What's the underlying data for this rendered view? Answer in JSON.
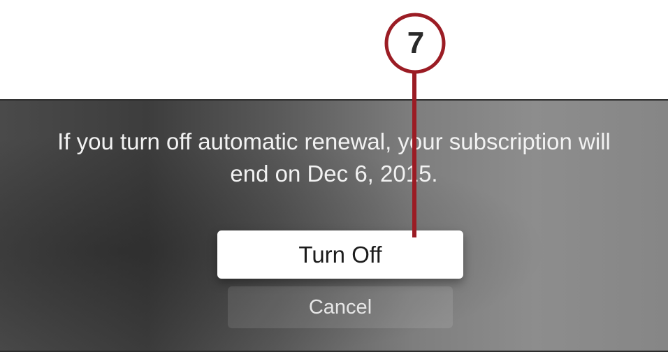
{
  "dialog": {
    "message_line1": "If you turn off automatic renewal, your subscription will",
    "message_line2": "end on Dec 6, 2015.",
    "primary_button": "Turn Off",
    "secondary_button": "Cancel"
  },
  "callout": {
    "step_number": "7",
    "color": "#9b1c24"
  },
  "colors": {
    "primary_button_bg": "#ffffff",
    "message_text": "#f2f2f2"
  }
}
